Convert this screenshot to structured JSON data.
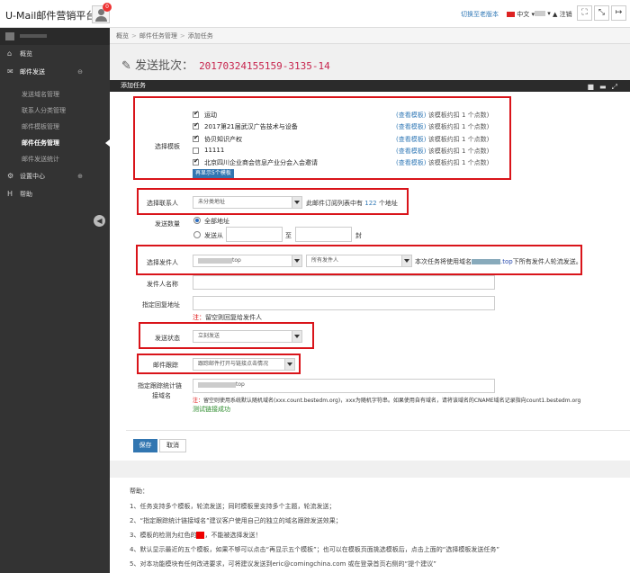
{
  "app": {
    "title": "U-Mail邮件营销平台",
    "badge": "0"
  },
  "topbar": {
    "switch_link": "切换至老版本",
    "language": "中文",
    "user_menu": "▾",
    "logout": "注销",
    "logout_prefix": "▲ "
  },
  "sidebar": {
    "items": [
      {
        "icon": "⌂",
        "label": "概览"
      },
      {
        "icon": "✉",
        "label": "邮件发送",
        "expand": "⊖"
      }
    ],
    "sub_items": [
      "发送域名管理",
      "联系人分类管理",
      "邮件模板管理",
      "邮件任务管理",
      "邮件发送统计"
    ],
    "bottom_items": [
      {
        "icon": "⚙",
        "label": "设置中心",
        "expand": "⊕"
      },
      {
        "icon": "H",
        "label": "帮助"
      }
    ]
  },
  "breadcrumb": [
    "概览",
    "邮件任务管理",
    "添加任务"
  ],
  "page": {
    "title": "发送批次：",
    "batch_id": "20170324155159-3135-14"
  },
  "panel": {
    "title": "添加任务"
  },
  "form": {
    "template_label": "选择模板",
    "templates": [
      {
        "name": "运动",
        "checked": true,
        "count": "1"
      },
      {
        "name": "2017第21届武汉广告技术与设备",
        "checked": true,
        "count": "1"
      },
      {
        "name": "协贝知识产权",
        "checked": true,
        "count": "1"
      },
      {
        "name": "11111",
        "checked": false,
        "count": "1"
      },
      {
        "name": "北京四川企业商会信息产业分会入会邀请",
        "checked": true,
        "count": "1"
      }
    ],
    "tpl_view": "(查看模板)",
    "tpl_meta_prefix": "该模板约扣",
    "tpl_meta_suffix": "个点数)",
    "show5_btn": "再显示5个模板",
    "contact_label": "选择联系人",
    "contact_select": "未分类地址",
    "contact_note_prefix": "此邮件订阅列表中有",
    "contact_count": "122",
    "contact_note_suffix": "个地址",
    "send_count_label": "发送数量",
    "opt_all": "全部地址",
    "opt_range": "发送从",
    "range_to": "至",
    "range_unit": "封",
    "sender_label": "选择发件人",
    "sender_domain_suffix": "top",
    "sender_select": "所有发件人",
    "sender_note_prefix": "本次任务将使用域名",
    "sender_note_domain": ".top",
    "sender_note_suffix": "下所有发件人轮流发送。",
    "sender_name_label": "发件人名称",
    "reply_label": "指定回复地址",
    "reply_note_prefix": "注：",
    "reply_note": "留空则回复给发件人",
    "status_label": "发送状态",
    "status_select": "立刻发送",
    "track_label": "邮件跟踪",
    "track_select": "跟踪邮件打开与链接点击情况",
    "trackdomain_label_1": "指定跟踪统计链",
    "trackdomain_label_2": "接域名",
    "trackdomain_value": "top",
    "trackdomain_note_prefix": "注：",
    "trackdomain_note": "留空则使用系统默认随机域名(xxx.count.bestedm.org)，xxx为随机字符串。如果使用自有域名，请将该域名的CNAME域名记录指向count1.bestedm.org",
    "test_link": "测试链接成功",
    "save": "保存",
    "cancel": "取消"
  },
  "help": {
    "title": "帮助：",
    "lines": [
      "1、任务支持多个模板，轮流发送；同时模板里支持多个主题，轮流发送；",
      "2、“指定跟踪统计链接域名”建议客户使用自己的独立的域名跟踪发送效果；",
      "3、模板的检测为红色的",
      "，不能被选择发送！",
      "4、默认显示最近的五个模板，如果不够可以点击“再显示五个模板”；也可以在模板页面挑选模板后，点击上面的“选择模板发送任务”",
      "5、对本功能模块有任何改进要求，可将建议发送到eric@comingchina.com 或在登录首页右侧的“提个建议”"
    ]
  },
  "colors": {
    "accent": "#3276b1",
    "danger": "#d9141a",
    "batch": "#c7254e",
    "sidebar": "#333333"
  }
}
